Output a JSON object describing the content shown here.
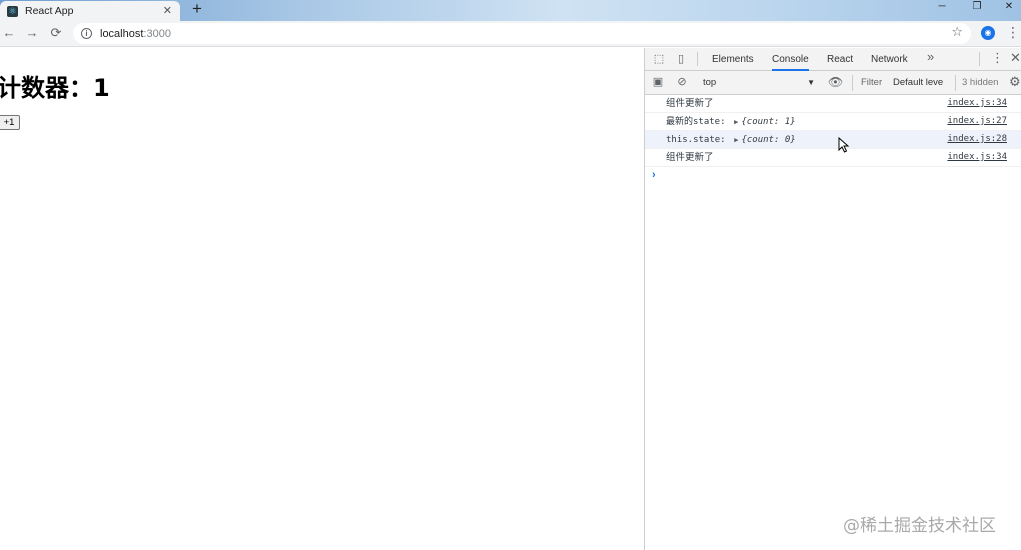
{
  "browser": {
    "tab_title": "React App",
    "tab_close_glyph": "✕",
    "new_tab_glyph": "+",
    "url_host": "localhost",
    "url_port": ":3000",
    "window_controls": [
      "─",
      "❐",
      "✕"
    ]
  },
  "page": {
    "title": "计数器：1",
    "increment_label": "+1"
  },
  "devtools": {
    "tabs": [
      "Elements",
      "Console",
      "React",
      "Network"
    ],
    "active_tab": "Console",
    "more_tabs_glyph": "»",
    "context": "top",
    "filter_placeholder": "Filter",
    "levels_label": "Default leve",
    "hidden_label": "3 hidden",
    "console_logs": [
      {
        "text": "组件更新了",
        "object": "",
        "source": "index.js:34"
      },
      {
        "text": "最新的state:",
        "object": "{count: 1}",
        "source": "index.js:27"
      },
      {
        "text": "this.state:",
        "object": "{count: 0}",
        "source": "index.js:28"
      },
      {
        "text": "组件更新了",
        "object": "",
        "source": "index.js:34"
      }
    ],
    "prompt_glyph": "›"
  },
  "watermark": "@稀土掘金技术社区",
  "colors": {
    "accent": "#1a73e8",
    "tab_bg": "#f1f3f4",
    "devtools_bar": "#f3f3f3"
  }
}
